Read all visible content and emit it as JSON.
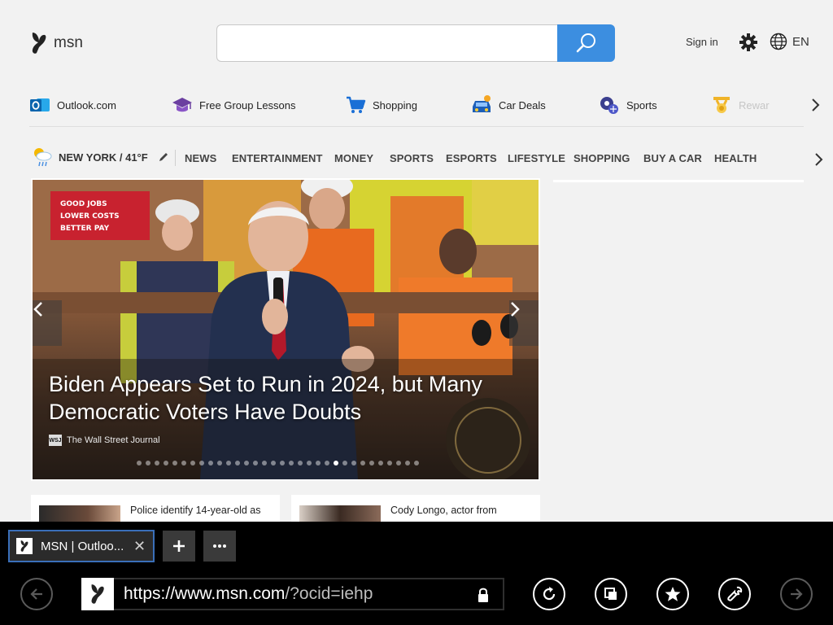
{
  "header": {
    "logo_text": "msn",
    "search_placeholder": "",
    "signin_label": "Sign in",
    "language": "EN"
  },
  "quicklinks": [
    {
      "label": "Outlook.com",
      "icon": "outlook-icon"
    },
    {
      "label": "Free Group Lessons",
      "icon": "graduation-cap-icon"
    },
    {
      "label": "Shopping",
      "icon": "shopping-cart-icon"
    },
    {
      "label": "Car Deals",
      "icon": "car-icon"
    },
    {
      "label": "Sports",
      "icon": "sports-balls-icon"
    },
    {
      "label": "Rewar",
      "icon": "medal-icon"
    }
  ],
  "nav": {
    "weather": "NEW YORK / 41°F",
    "items": [
      "NEWS",
      "ENTERTAINMENT",
      "MONEY",
      "SPORTS",
      "ESPORTS",
      "LIFESTYLE",
      "SHOPPING",
      "BUY A CAR",
      "HEALTH"
    ]
  },
  "hero": {
    "title": "Biden Appears Set to Run in 2024, but Many Democratic Voters Have Doubts",
    "source": "The Wall Street Journal",
    "source_badge": "WSJ",
    "slide_count": 32,
    "active_slide_index": 22,
    "sign_text": [
      "GOOD JOBS",
      "LOWER COSTS",
      "BETTER PAY"
    ]
  },
  "cards": [
    {
      "text": "Police identify 14-year-old as"
    },
    {
      "text": "Cody Longo, actor from"
    }
  ],
  "browser": {
    "tab_title": "MSN | Outloo...",
    "url_host": "https://www.msn.com",
    "url_rest": "/?ocid=iehp"
  },
  "colors": {
    "accent": "#3c8ee0",
    "background": "#f2f2f2",
    "browser_bar": "#000000",
    "tab_border": "#3a6fb9"
  }
}
